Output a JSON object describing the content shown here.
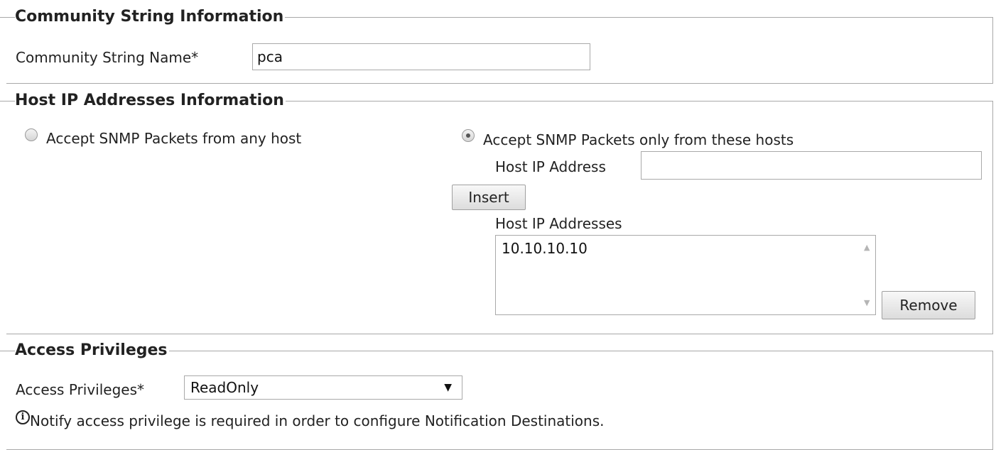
{
  "community": {
    "legend": "Community String Information",
    "name_label": "Community String Name*",
    "name_value": "pca"
  },
  "hosts": {
    "legend": "Host IP Addresses Information",
    "radio_any_label": "Accept SNMP Packets from any host",
    "radio_any_checked": false,
    "radio_only_label": "Accept SNMP Packets only from these hosts",
    "radio_only_checked": true,
    "host_ip_label": "Host IP Address",
    "host_ip_value": "",
    "insert_label": "Insert",
    "list_label": "Host IP Addresses",
    "list_items": [
      "10.10.10.10"
    ],
    "remove_label": "Remove"
  },
  "access": {
    "legend": "Access Privileges",
    "label": "Access Privileges*",
    "selected": "ReadOnly",
    "note": "Notify access privilege is required in order to configure Notification Destinations.",
    "info_icon": "info-icon"
  }
}
